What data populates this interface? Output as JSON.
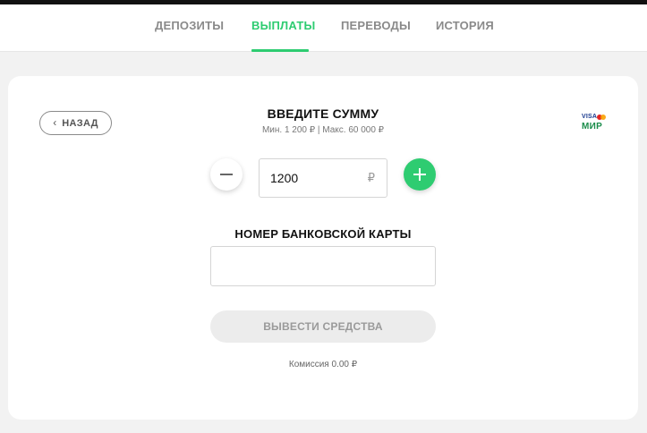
{
  "colors": {
    "accent": "#2ecc71",
    "tab_inactive": "#8a8a8a",
    "background": "#f2f2f2"
  },
  "tabs": [
    {
      "label": "ДЕПОЗИТЫ",
      "active": false
    },
    {
      "label": "ВЫПЛАТЫ",
      "active": true
    },
    {
      "label": "ПЕРЕВОДЫ",
      "active": false
    },
    {
      "label": "ИСТОРИЯ",
      "active": false
    }
  ],
  "back_button": {
    "label": "НАЗАД",
    "icon": "chevron-left-icon"
  },
  "amount_section": {
    "title": "ВВЕДИТЕ СУММУ",
    "limits": "Мин. 1 200 ₽ | Макс. 60 000 ₽",
    "value": "1200",
    "currency": "₽",
    "minus_icon": "minus-icon",
    "plus_icon": "plus-icon"
  },
  "payment_logos": {
    "visa": "VISA",
    "mir": "МИР"
  },
  "card_section": {
    "label": "НОМЕР БАНКОВСКОЙ КАРТЫ",
    "value": "",
    "placeholder": ""
  },
  "submit": {
    "label": "ВЫВЕСТИ СРЕДСТВА"
  },
  "commission": "Комиссия  0.00 ₽"
}
